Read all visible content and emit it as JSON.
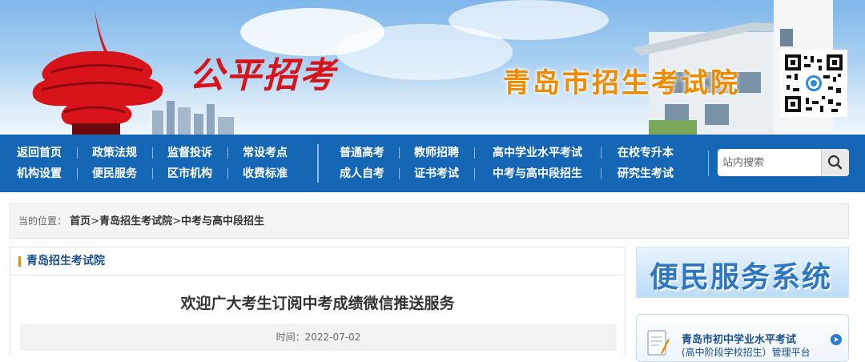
{
  "header": {
    "slogan": "公平招考",
    "site_title": "青岛市招生考试院"
  },
  "nav": {
    "left": [
      [
        "返回首页",
        "机构设置"
      ],
      [
        "政策法规",
        "便民服务"
      ],
      [
        "监督投诉",
        "区市机构"
      ],
      [
        "常设考点",
        "收费标准"
      ]
    ],
    "right": [
      {
        "top": "普通高考",
        "bottom": "成人自考"
      },
      {
        "top": "教师招聘",
        "bottom": "证书考试"
      },
      {
        "top": "高中学业水平考试",
        "bottom": "中考与高中段招生"
      },
      {
        "top": "在校专升本",
        "bottom": "研究生考试"
      }
    ],
    "search_placeholder": "站内搜索"
  },
  "breadcrumb": {
    "prefix": "当的位置：",
    "items": [
      "首页",
      "青岛招生考试院",
      "中考与高中段招生"
    ],
    "separator": ">"
  },
  "main": {
    "section_title": "青岛招生考试院",
    "article_title": "欢迎广大考生订阅中考成绩微信推送服务",
    "date_label": "时间：2022-07-02"
  },
  "sidebar": {
    "banner_text": "便民服务系统",
    "card_line1": "青岛市初中学业水平考试",
    "card_line2": "(高中阶段学校招生）管理平台"
  },
  "colors": {
    "nav_bg": "#1567b5",
    "title_orange": "#f08a00",
    "slogan_red": "#d8141b"
  }
}
